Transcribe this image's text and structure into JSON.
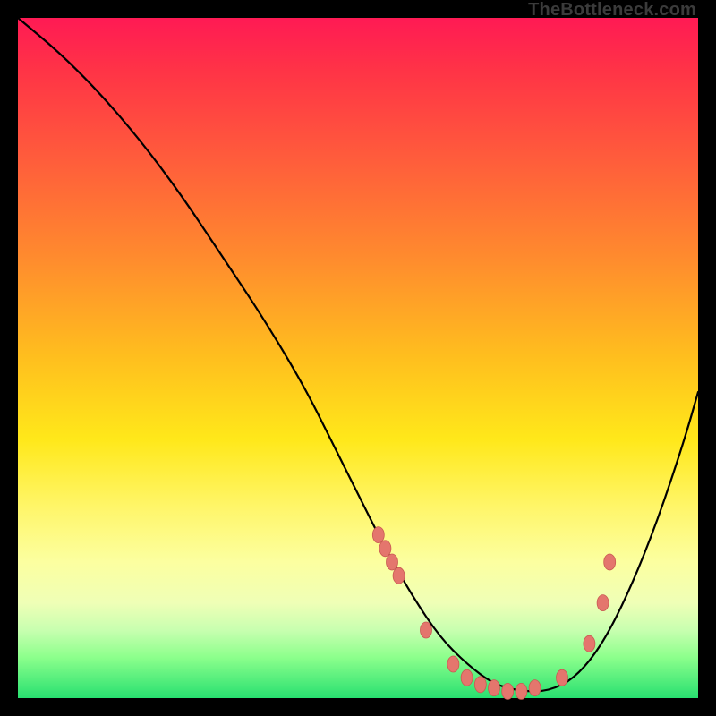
{
  "watermark": "TheBottleneck.com",
  "chart_data": {
    "type": "line",
    "title": "",
    "xlabel": "",
    "ylabel": "",
    "xlim": [
      0,
      100
    ],
    "ylim": [
      0,
      100
    ],
    "grid": false,
    "note": "Axes unlabeled; values are relative percentages read from plot area (0 = bottom/left, 100 = top/right).",
    "series": [
      {
        "name": "curve",
        "x": [
          0,
          6,
          12,
          18,
          24,
          30,
          36,
          42,
          46,
          50,
          54,
          58,
          62,
          66,
          70,
          74,
          78,
          82,
          86,
          90,
          94,
          98,
          100
        ],
        "y": [
          100,
          95,
          89,
          82,
          74,
          65,
          56,
          46,
          38,
          30,
          22,
          15,
          9,
          5,
          2,
          1,
          1,
          3,
          8,
          16,
          26,
          38,
          45
        ]
      }
    ],
    "markers": {
      "name": "highlighted-points",
      "color": "#e4766d",
      "x": [
        53,
        54,
        55,
        56,
        60,
        64,
        66,
        68,
        70,
        72,
        74,
        76,
        80,
        84,
        86,
        87
      ],
      "y": [
        24,
        22,
        20,
        18,
        10,
        5,
        3,
        2,
        1.5,
        1,
        1,
        1.5,
        3,
        8,
        14,
        20
      ]
    },
    "background_gradient": {
      "direction": "vertical",
      "stops": [
        {
          "pos": 0,
          "color": "#ff1a54"
        },
        {
          "pos": 35,
          "color": "#ff8a2e"
        },
        {
          "pos": 62,
          "color": "#ffe81a"
        },
        {
          "pos": 86,
          "color": "#efffb6"
        },
        {
          "pos": 100,
          "color": "#28e070"
        }
      ]
    }
  }
}
